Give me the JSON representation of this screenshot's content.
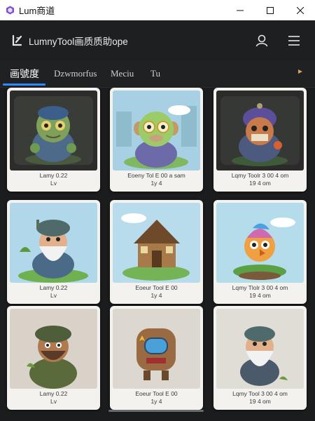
{
  "window": {
    "title": "Lum商道"
  },
  "header": {
    "title": "LumnyTool画质质助ope"
  },
  "tabs": [
    {
      "label": "画號度",
      "active": true
    },
    {
      "label": "Dzwmorfus",
      "active": false
    },
    {
      "label": "Meciu",
      "active": false
    },
    {
      "label": "Tu",
      "active": false
    }
  ],
  "colors": {
    "accent": "#2d87ff",
    "background": "#1b1c1e"
  },
  "cards": [
    {
      "line1": "Lamy 0.22",
      "line2": "Lv",
      "scene": "dark-green-goblin"
    },
    {
      "line1": "Eoeny Tol E 00 a sam",
      "line2": "1y  4",
      "scene": "green-monkey"
    },
    {
      "line1": "Lqmy Toolr 3 00  4 om",
      "line2": "19  4  om",
      "scene": "dark-purple-knight"
    },
    {
      "line1": "Lamy 0.22",
      "line2": "Lv",
      "scene": "old-wizard-grass"
    },
    {
      "line1": "Eoeur Tool E 00",
      "line2": "1y  4",
      "scene": "wooden-house"
    },
    {
      "line1": "Lqmy Tlolr 3 00  4 om",
      "line2": "19  4  om",
      "scene": "rainbow-bird"
    },
    {
      "line1": "Lamy 0.22",
      "line2": "Lv",
      "scene": "camo-soldier"
    },
    {
      "line1": "Eoeur Tool E 00",
      "line2": "1y  4",
      "scene": "robot-monster"
    },
    {
      "line1": "Lqmy Tool 3 00  4 om",
      "line2": "19  4  om",
      "scene": "old-wizard-plain"
    }
  ]
}
